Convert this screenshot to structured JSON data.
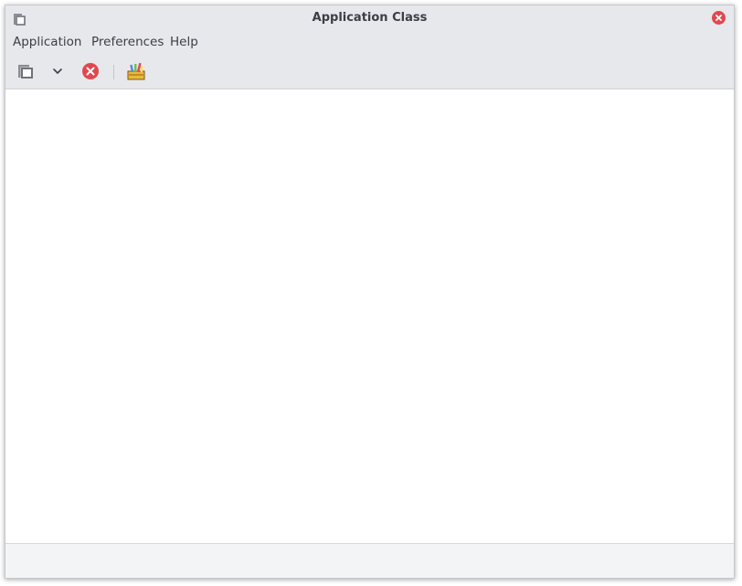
{
  "window": {
    "title": "Application Class",
    "icon": "window-stack-icon",
    "close_icon": "close-icon"
  },
  "menubar": {
    "items": [
      {
        "label": "Application"
      },
      {
        "label": "Preferences"
      },
      {
        "label": "Help"
      }
    ]
  },
  "toolbar": {
    "buttons": [
      {
        "icon": "window-stack-icon"
      },
      {
        "icon": "chevron-down-icon"
      },
      {
        "icon": "stop-icon"
      },
      {
        "icon": "toolbox-icon"
      }
    ]
  },
  "colors": {
    "chrome": "#e7e8eb",
    "close_red": "#e0484e",
    "text": "#3b3e45"
  }
}
